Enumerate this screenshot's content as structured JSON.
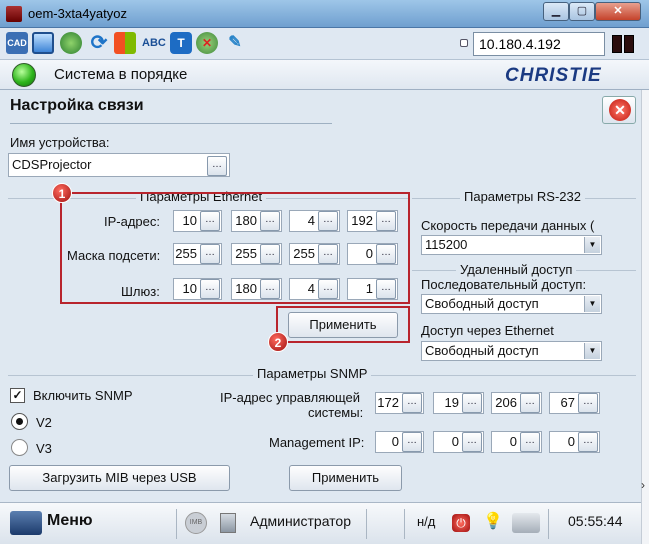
{
  "window": {
    "title": "oem-3xta4yatyoz",
    "min": "▁",
    "max": "▢",
    "close": "✕"
  },
  "toolbar": {
    "icons": [
      "cad-icon",
      "window-icon",
      "globe-icon",
      "refresh-icon",
      "windows-flag-icon",
      "abc-spell-icon",
      "thermometer-icon",
      "network-error-icon",
      "palette-icon"
    ],
    "ip": "10.180.4.192"
  },
  "status": {
    "text": "Система в порядке",
    "brand": "CHRISTIE",
    "led_color": "#2eb51c"
  },
  "page": {
    "title": "Настройка связи"
  },
  "device": {
    "label": "Имя устройства:",
    "value": "CDSProjector"
  },
  "ethernet": {
    "section": "Параметры Ethernet",
    "ip_label": "IP-адрес:",
    "ip": [
      "10",
      "180",
      "4",
      "192"
    ],
    "mask_label": "Маска подсети:",
    "mask": [
      "255",
      "255",
      "255",
      "0"
    ],
    "gw_label": "Шлюз:",
    "gw": [
      "10",
      "180",
      "4",
      "1"
    ],
    "apply": "Применить",
    "badge1": "1",
    "badge2": "2"
  },
  "rs232": {
    "section": "Параметры RS-232",
    "speed_label": "Скорость передачи данных (",
    "speed": "115200"
  },
  "remote": {
    "section": "Удаленный доступ",
    "serial_label": "Последовательный доступ:",
    "serial": "Свободный доступ",
    "eth_label": "Доступ через Ethernet",
    "eth": "Свободный доступ"
  },
  "snmp": {
    "section": "Параметры SNMP",
    "enable": "Включить SNMP",
    "enabled": true,
    "v2": "V2",
    "v3": "V3",
    "version": "V2",
    "mgr_label_1": "IP-адрес управляющей",
    "mgr_label_2": "системы:",
    "mgr_ip": [
      "172",
      "19",
      "206",
      "67"
    ],
    "mgmt_label": "Management IP:",
    "mgmt_ip": [
      "0",
      "0",
      "0",
      "0"
    ],
    "mib": "Загрузить MIB через USB",
    "apply": "Применить"
  },
  "taskbar": {
    "menu": "Меню",
    "mib_badge": "IMB",
    "user": "Администратор",
    "na": "н/д",
    "time": "05:55:44"
  },
  "colors": {
    "callout": "#b8242d",
    "panel": "#dfe8f1",
    "brand": "#1b3a82"
  }
}
